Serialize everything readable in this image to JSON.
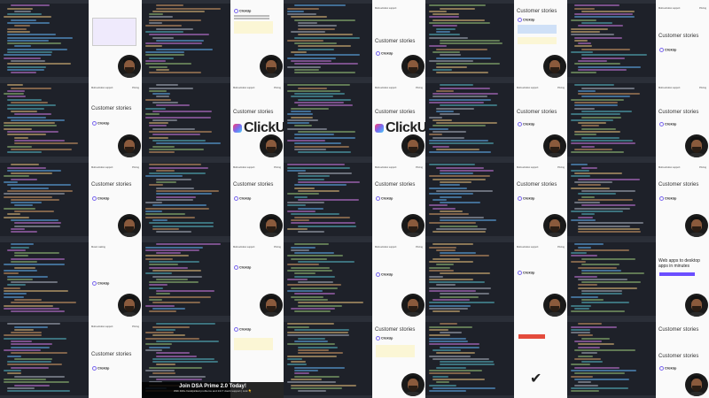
{
  "pane_texts": {
    "top_link": "Multi-window support",
    "top_right": "Pricing",
    "customer_stories": "Customer stories",
    "clickup_small": "ClickUp",
    "clickup_big": "ClickUp",
    "desktop_apps": "Web apps to desktop apps in minutes",
    "music_player": "Music making"
  },
  "promo": {
    "headline": "Join DSA Prime 2.0 Today!",
    "subline": "With 400+ handpicked problems and 24×7 doubt support | Link 👇"
  },
  "colors": {
    "editor_bg": "#1e2129",
    "pane_bg": "#fafafa",
    "accent": "#7b68ee",
    "highlight_yellow": "#fbf6d5",
    "highlight_blue": "#cfe0f7"
  }
}
